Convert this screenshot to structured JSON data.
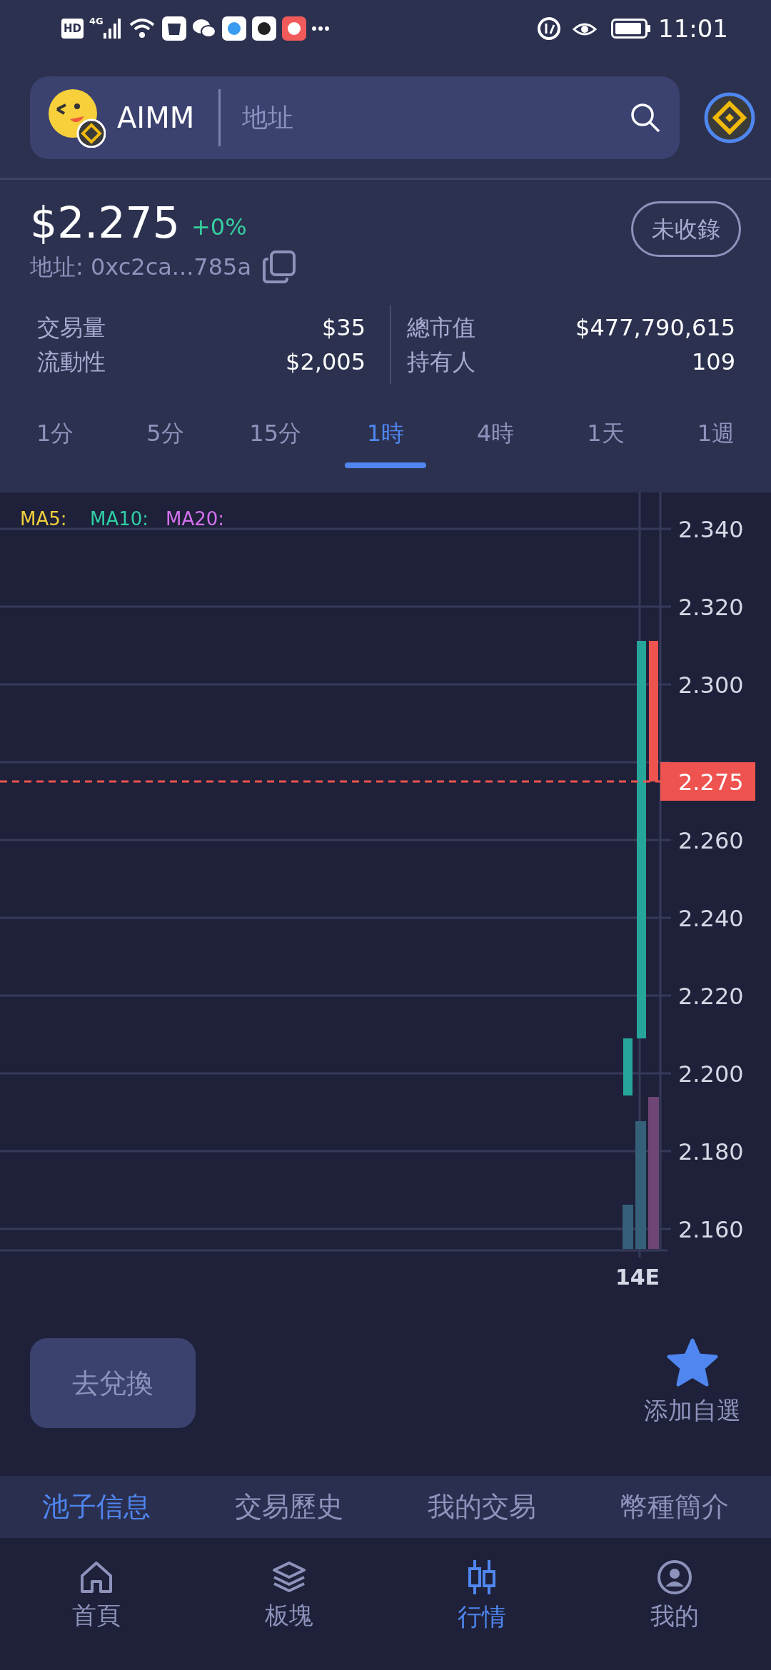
{
  "status_bar": {
    "network": [
      "HD",
      "4G"
    ],
    "time": "11:01"
  },
  "header": {
    "token_name": "AIMM",
    "search": {
      "placeholder": "地址"
    }
  },
  "price": {
    "value": "$2.275",
    "change": "+0%",
    "address": "地址: 0xc2ca...785a",
    "listing_button": "未收錄"
  },
  "stats": [
    {
      "label": "交易量",
      "value": "$35"
    },
    {
      "label": "流動性",
      "value": "$2,005"
    },
    {
      "label": "總市值",
      "value": "$477,790,615"
    },
    {
      "label": "持有人",
      "value": "109"
    }
  ],
  "intervals": [
    {
      "label": "1分",
      "selected": false
    },
    {
      "label": "5分",
      "selected": false
    },
    {
      "label": "15分",
      "selected": false
    },
    {
      "label": "1時",
      "selected": true
    },
    {
      "label": "4時",
      "selected": false
    },
    {
      "label": "1天",
      "selected": false
    },
    {
      "label": "1週",
      "selected": false
    }
  ],
  "chart": {
    "legend": [
      {
        "label": "MA5:",
        "color": "#f2cf3c"
      },
      {
        "label": "MA10:",
        "color": "#2fd0a5"
      },
      {
        "label": "MA20:",
        "color": "#d470ee"
      }
    ],
    "price_ticks": [
      "2.340",
      "2.320",
      "2.300",
      "2.260",
      "2.240",
      "2.220",
      "2.200",
      "2.180",
      "2.160"
    ],
    "current_price": "2.275",
    "time_label": "14E"
  },
  "actions": {
    "swap_button": "去兌換",
    "watchlist": "添加自選"
  },
  "detail_tabs": [
    {
      "label": "池子信息",
      "selected": true
    },
    {
      "label": "交易歷史",
      "selected": false
    },
    {
      "label": "我的交易",
      "selected": false
    },
    {
      "label": "幣種簡介",
      "selected": false
    }
  ],
  "bottom_nav": [
    {
      "label": "首頁",
      "selected": false
    },
    {
      "label": "板塊",
      "selected": false
    },
    {
      "label": "行情",
      "selected": true
    },
    {
      "label": "我的",
      "selected": false
    }
  ]
}
